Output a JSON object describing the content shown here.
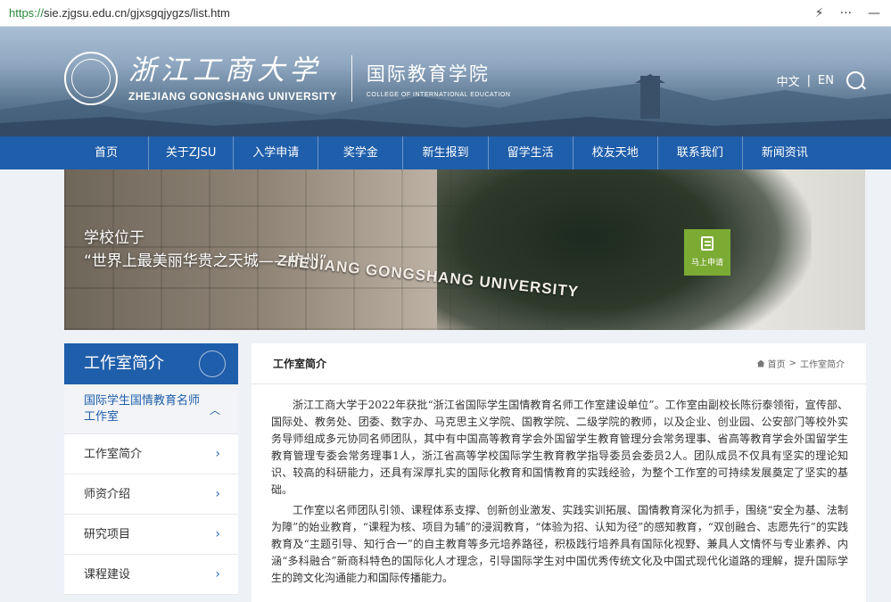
{
  "browser": {
    "url_protocol": "https://",
    "url_rest": "sie.zjgsu.edu.cn/gjxsgqjygzs/list.htm",
    "flash_icon": "lightning-icon",
    "more_icon": "more-icon",
    "minimize_label": "—"
  },
  "header": {
    "university_cn": "浙江工商大学",
    "university_en": "ZHEJIANG GONGSHANG UNIVERSITY",
    "college_cn": "国际教育学院",
    "college_en": "COLLEGE OF INTERNATIONAL EDUCATION",
    "lang_cn": "中文",
    "lang_sep": "|",
    "lang_en": "EN"
  },
  "nav": [
    {
      "label": "首页"
    },
    {
      "label": "关于ZJSU"
    },
    {
      "label": "入学申请"
    },
    {
      "label": "奖学金"
    },
    {
      "label": "新生报到"
    },
    {
      "label": "留学生活"
    },
    {
      "label": "校友天地"
    },
    {
      "label": "联系我们"
    },
    {
      "label": "新闻资讯"
    }
  ],
  "banner": {
    "caption_line1": "学校位于",
    "caption_line2": "“世界上最美丽华贵之天城——杭州”",
    "engraving": "ZHEJIANG GONGSHANG UNIVERSITY",
    "apply_label": "马上申请"
  },
  "sidebar": {
    "title": "工作室简介",
    "active_group": "国际学生国情教育名师工作室",
    "items": [
      {
        "label": "工作室简介"
      },
      {
        "label": "师资介绍"
      },
      {
        "label": "研究项目"
      },
      {
        "label": "课程建设"
      }
    ]
  },
  "main": {
    "title": "工作室简介",
    "breadcrumb_home": "首页",
    "breadcrumb_sep": ">",
    "breadcrumb_current": "工作室简介",
    "paragraphs": [
      "浙江工商大学于2022年获批“浙江省国际学生国情教育名师工作室建设单位”。工作室由副校长陈衍泰领衔，宣传部、国际处、教务处、团委、数字办、马克思主义学院、国教学院、二级学院的教师，以及企业、创业园、公安部门等校外实务导师组成多元协同名师团队，其中有中国高等教育学会外国留学生教育管理分会常务理事、省高等教育学会外国留学生教育管理专委会常务理事1人，浙江省高等学校国际学生教育教学指导委员会委员2人。团队成员不仅具有坚实的理论知识、较高的科研能力，还具有深厚扎实的国际化教育和国情教育的实践经验，为整个工作室的可持续发展奠定了坚实的基础。",
      "工作室以名师团队引领、课程体系支撑、创新创业激发、实践实训拓展、国情教育深化为抓手，围绕“安全为基、法制为障”的始业教育，“课程为核、项目为辅”的浸润教育，“体验为招、认知为径”的感知教育，“双创融合、志愿先行”的实践教育及“主题引导、知行合一”的自主教育等多元培养路径，积极践行培养具有国际化视野、兼具人文情怀与专业素养、内涵“多科融合”新商科特色的国际化人才理念，引导国际学生对中国优秀传统文化及中国式现代化道路的理解，提升国际学生的跨文化沟通能力和国际传播能力。"
    ]
  },
  "colors": {
    "primary_blue": "#1f5eaa",
    "apply_green": "#7cab34"
  }
}
